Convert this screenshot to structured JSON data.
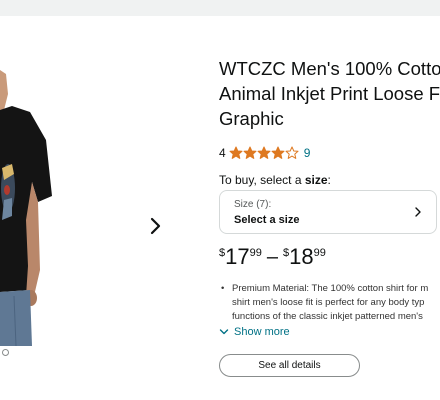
{
  "product": {
    "title_lines": [
      "WTCZC Men's 100% Cotto",
      "Animal Inkjet Print Loose F",
      "Graphic"
    ],
    "rating_value": "4",
    "stars_filled": 4,
    "stars_total": 5,
    "rating_count": "9",
    "star_color": "#de7921",
    "link_color": "#007185"
  },
  "buy": {
    "prompt_prefix": "To buy, select a",
    "prompt_bold": "size",
    "prompt_suffix": ":"
  },
  "size_selector": {
    "count_label": "Size (7):",
    "select_label": "Select a size",
    "icon": "chevron-right-icon"
  },
  "price_range": {
    "low": {
      "symbol": "$",
      "whole": "17",
      "fraction": "99"
    },
    "separator": "–",
    "high": {
      "symbol": "$",
      "whole": "18",
      "fraction": "99"
    }
  },
  "bullets": [
    {
      "lines": [
        "Premium Material: The 100% cotton shirt for m",
        "shirt men's loose fit is perfect for any body typ",
        "functions of the classic inkjet patterned men's"
      ]
    }
  ],
  "show_more": {
    "label": "Show more",
    "icon": "chevron-down-icon"
  },
  "see_all": {
    "label": "See all details"
  },
  "gallery": {
    "next_icon": "chevron-right-icon",
    "image_label": "product-photo"
  }
}
